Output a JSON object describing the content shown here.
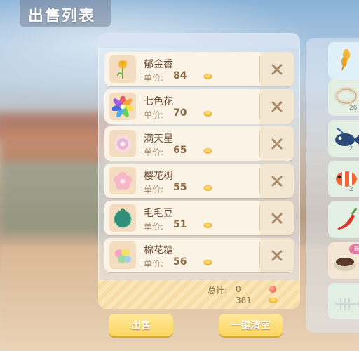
{
  "header": {
    "title": "出售列表"
  },
  "sell_list": {
    "price_label": "单价:",
    "items": [
      {
        "name": "郁金香",
        "price": "84",
        "icon": "tulip-icon"
      },
      {
        "name": "七色花",
        "price": "70",
        "icon": "rainbow-flower-icon"
      },
      {
        "name": "满天星",
        "price": "65",
        "icon": "babys-breath-icon"
      },
      {
        "name": "樱花树",
        "price": "55",
        "icon": "cherry-blossom-icon"
      },
      {
        "name": "毛毛豆",
        "price": "51",
        "icon": "fuzzy-bean-icon"
      },
      {
        "name": "棉花糖",
        "price": "56",
        "icon": "cotton-candy-icon"
      }
    ],
    "total_label": "总计:",
    "total_gems": "0",
    "total_coins": "381"
  },
  "buttons": {
    "sell": "出售",
    "clear_all": "一键清空"
  },
  "inventory": {
    "cells": [
      {
        "icon": "wheat-icon",
        "count": ""
      },
      {
        "icon": "rope-icon",
        "count": "26"
      },
      {
        "icon": "fish-icon",
        "count": "2"
      },
      {
        "icon": "clownfish-icon",
        "count": "2"
      },
      {
        "icon": "chili-pepper-icon",
        "count": ""
      },
      {
        "icon": "soil-bowl-icon",
        "count": "",
        "badge": "新"
      },
      {
        "icon": "fish-bone-icon",
        "count": ""
      }
    ]
  },
  "colors": {
    "item_bg": "#fbf4e6",
    "button": "#fbd662",
    "text_brown": "#6a4a33"
  }
}
